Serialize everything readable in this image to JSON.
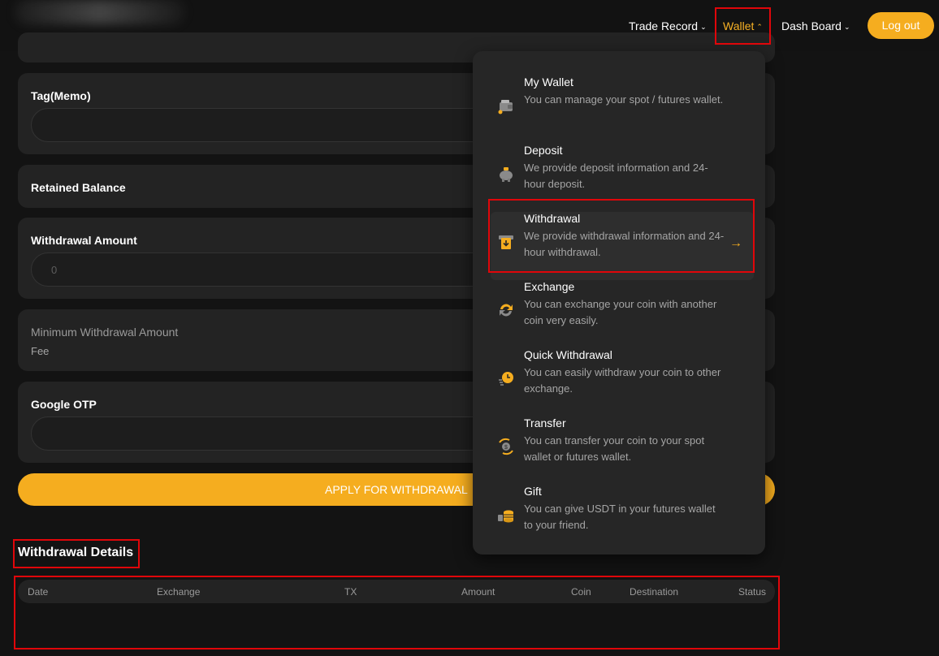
{
  "nav": {
    "trade_record": "Trade Record",
    "wallet": "Wallet",
    "dash_board": "Dash Board",
    "logout": "Log out"
  },
  "form": {
    "tag_label": "Tag(Memo)",
    "tag_value": "",
    "retained_balance_label": "Retained Balance",
    "withdrawal_amount_label": "Withdrawal Amount",
    "withdrawal_amount_placeholder": "0",
    "min_withdrawal_label": "Minimum Withdrawal Amount",
    "fee_label": "Fee",
    "google_otp_label": "Google OTP",
    "google_otp_value": "",
    "apply_button": "APPLY FOR WITHDRAWAL"
  },
  "details": {
    "title": "Withdrawal Details",
    "columns": [
      "Date",
      "Exchange",
      "TX",
      "Amount",
      "Coin",
      "Destination",
      "Status"
    ],
    "rows": []
  },
  "wallet_menu": {
    "items": [
      {
        "title": "My Wallet",
        "desc": "You can manage your spot / futures wallet.",
        "icon": "wallet-icon"
      },
      {
        "title": "Deposit",
        "desc": "We provide deposit information and 24-hour deposit.",
        "icon": "piggy-bank-icon"
      },
      {
        "title": "Withdrawal",
        "desc": "We provide withdrawal information and 24-hour withdrawal.",
        "icon": "atm-withdraw-icon"
      },
      {
        "title": "Exchange",
        "desc": "You can exchange your coin with another coin very easily.",
        "icon": "exchange-icon"
      },
      {
        "title": "Quick Withdrawal",
        "desc": "You can easily withdraw your coin to other exchange.",
        "icon": "fast-clock-icon"
      },
      {
        "title": "Transfer",
        "desc": "You can transfer your coin to your spot wallet or futures wallet.",
        "icon": "transfer-coin-icon"
      },
      {
        "title": "Gift",
        "desc": "You can give USDT in your futures wallet to your friend.",
        "icon": "coin-stack-icon"
      }
    ]
  },
  "colors": {
    "accent": "#f5ad1f",
    "highlight": "#e0060a",
    "card": "#232323"
  }
}
